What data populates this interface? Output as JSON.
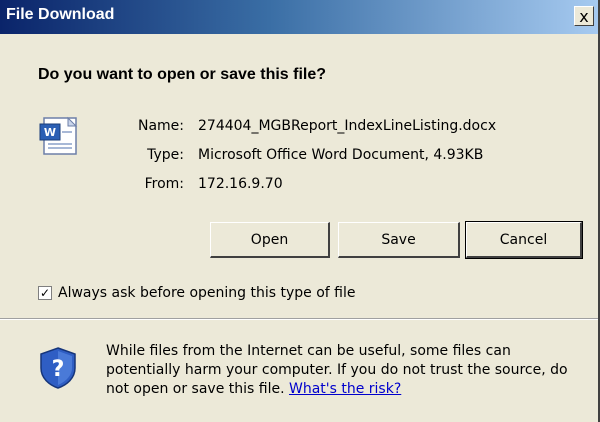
{
  "window": {
    "title": "File Download",
    "close_glyph": "x"
  },
  "prompt": {
    "question": "Do you want to open or save this file?"
  },
  "file": {
    "icon": "word-document-icon",
    "name_label": "Name:",
    "name_value": "274404_MGBReport_IndexLineListing.docx",
    "type_label": "Type:",
    "type_value": "Microsoft Office Word Document, 4.93KB",
    "from_label": "From:",
    "from_value": "172.16.9.70"
  },
  "buttons": {
    "open": "Open",
    "save": "Save",
    "cancel": "Cancel"
  },
  "checkbox": {
    "checked": true,
    "mark": "✓",
    "label": "Always ask before opening this type of file"
  },
  "warning": {
    "icon": "question-shield-icon",
    "text": "While files from the Internet can be useful, some files can potentially harm your computer. If you do not trust the source, do not open or save this file.",
    "link": "What's the risk?"
  },
  "colors": {
    "title_bar_start": "#0a246a",
    "title_bar_end": "#a6caf0",
    "dialog_bg": "#ece9d8",
    "link": "#0000cc"
  }
}
